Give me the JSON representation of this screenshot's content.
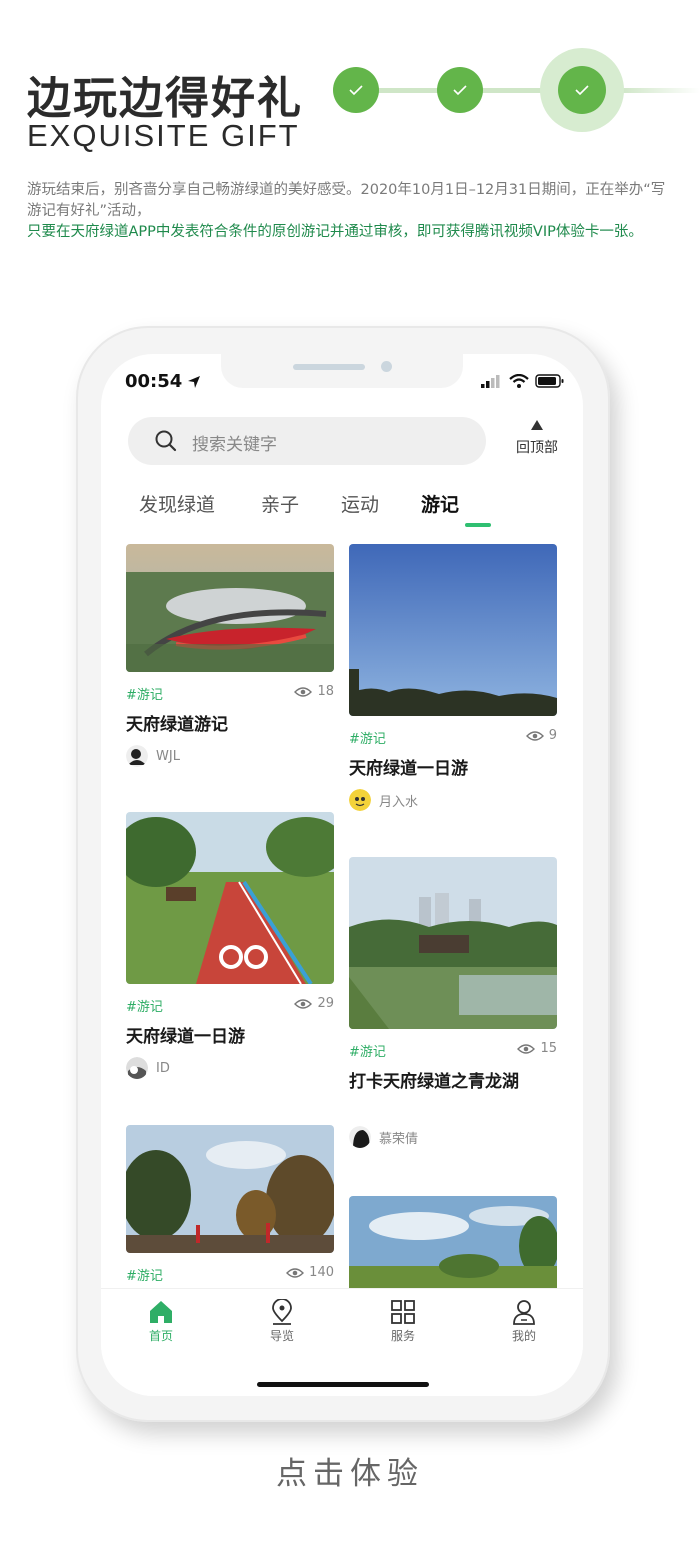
{
  "header": {
    "title_cn": "边玩边得好礼",
    "title_en": "EXQUISITE GIFT",
    "desc_gray": "游玩结束后，别吝啬分享自己畅游绿道的美好感受。2020年10月1日–12月31日期间，正在举办“写游记有好礼”活动，",
    "desc_green": "只要在天府绿道APP中发表符合条件的原创游记并通过审核，即可获得腾讯视频VIP体验卡一张。"
  },
  "colors": {
    "accent": "#2fae66",
    "step": "#63b54a"
  },
  "phone": {
    "status": {
      "time": "00:54"
    },
    "search": {
      "placeholder": "搜索关键字"
    },
    "back_to_top": "回顶部",
    "tabs": [
      {
        "label": "发现绿道"
      },
      {
        "label": "亲子"
      },
      {
        "label": "运动"
      },
      {
        "label": "游记",
        "active": true
      }
    ],
    "cards": [
      {
        "tag": "#游记",
        "views": "18",
        "title": "天府绿道游记",
        "author": "WJL"
      },
      {
        "tag": "#游记",
        "views": "9",
        "title": "天府绿道一日游",
        "author": "月入水"
      },
      {
        "tag": "#游记",
        "views": "29",
        "title": "天府绿道一日游",
        "author": "ID"
      },
      {
        "tag": "#游记",
        "views": "15",
        "title": "打卡天府绿道之青龙湖",
        "author": "慕荣倩"
      },
      {
        "tag": "#游记",
        "views": "140"
      }
    ],
    "tabbar": [
      {
        "label": "首页",
        "icon": "home-icon",
        "active": true
      },
      {
        "label": "导览",
        "icon": "location-pin-icon"
      },
      {
        "label": "服务",
        "icon": "grid-icon"
      },
      {
        "label": "我的",
        "icon": "user-icon"
      }
    ]
  },
  "cta": "点击体验"
}
